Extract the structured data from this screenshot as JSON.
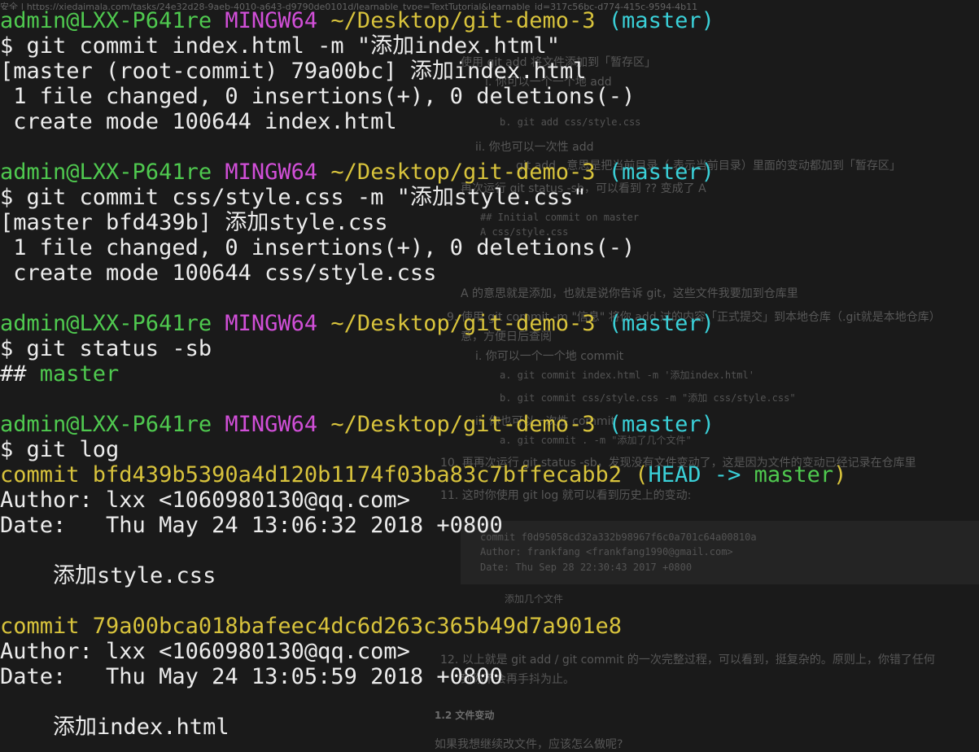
{
  "background_page": {
    "url_text": "安全 | https://xiedaimala.com/tasks/24e32d28-9aeb-4010-a643-d9790de0101d/learnable_type=TextTutorial&learnable_id=317c56bc-d774-415c-9594-4b11",
    "lines": [
      "使用 git add 将文件添加到「暂存区」",
      "i. 你可以一个一个地 add",
      "b. git add css/style.css",
      "ii. 你也可以一次性 add",
      "git add . 意思是把当前目录（.表示当前目录）里面的变动都加到「暂存区」",
      "再次运行 git status -sb，可以看到 ?? 变成了 A",
      "## Initial commit on master",
      "A  css/style.css",
      "A 的意思就是添加，也就是说你告诉 git，这些文件我要加到仓库里",
      "9. 使用 git commit -m \"信息\" 将你 add 过的内容「正式提交」到本地仓库（.git就是本地仓库）",
      "意，方便日后查阅",
      "i. 你可以一个一个地 commit",
      "a. git commit index.html -m '添加index.html'",
      "b. git commit css/style.css -m \"添加 css/style.css\"",
      "ii. 你也可以一次性 commit",
      "a. git commit . -m \"添加了几个文件\"",
      "10. 再再次运行 git status -sb，发现没有文件变动了，这是因为文件的变动已经记录在仓库里",
      "11. 这时你使用 git log 就可以看到历史上的变动:",
      "commit f0d95058cd32a332b98967f6c0a701c64a00810a",
      "Author: frankfang <frankfang1990@gmail.com>",
      "Date:   Thu Sep 28 22:30:43 2017 +0800",
      "添加几个文件",
      "12. 以上就是 git add / git commit 的一次完整过程，可以看到，挺复杂的。原则上，你错了任何",
      "到你不会再手抖为止。",
      "1.2 文件变动",
      "如果我想继续改文件，应该怎么做呢?"
    ]
  },
  "prompt": {
    "user": "admin@LXX-P641re",
    "env": "MINGW64",
    "path": "~/Desktop/git-demo-3",
    "branch": "(master)"
  },
  "terminal": {
    "cmd1": "$ git commit index.html -m \"添加index.html\"",
    "out1a": "[master (root-commit) 79a00bc] 添加index.html",
    "out1b": " 1 file changed, 0 insertions(+), 0 deletions(-)",
    "out1c": " create mode 100644 index.html",
    "cmd2": "$ git commit css/style.css -m \"添加style.css\"",
    "out2a": "[master bfd439b] 添加style.css",
    "out2b": " 1 file changed, 0 insertions(+), 0 deletions(-)",
    "out2c": " create mode 100644 css/style.css",
    "cmd3": "$ git status -sb",
    "out3_prefix": "## ",
    "out3_branch": "master",
    "cmd4": "$ git log",
    "log1_commit": "commit bfd439b5390a4d120b1174f03ba83c7bffecabb2",
    "log1_paren_open": " (",
    "log1_head": "HEAD -> ",
    "log1_master": "master",
    "log1_paren_close": ")",
    "log1_author": "Author: lxx <1060980130@qq.com>",
    "log1_date": "Date:   Thu May 24 13:06:32 2018 +0800",
    "log1_msg": "    添加style.css",
    "log2_commit": "commit 79a00bca018bafeec4dc6d263c365b49d7a901e8",
    "log2_author": "Author: lxx <1060980130@qq.com>",
    "log2_date": "Date:   Thu May 24 13:05:59 2018 +0800",
    "log2_msg": "    添加index.html"
  }
}
